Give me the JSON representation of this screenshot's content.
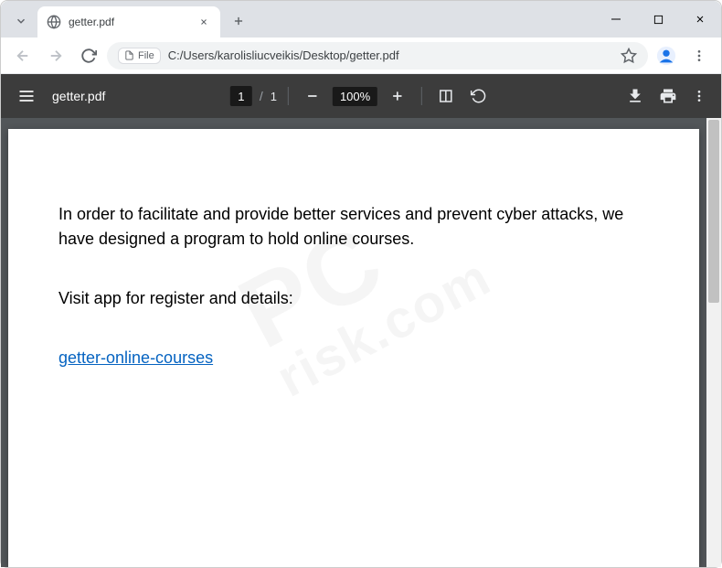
{
  "browser": {
    "tab_title": "getter.pdf",
    "file_chip": "File",
    "url": "C:/Users/karolisliucveikis/Desktop/getter.pdf"
  },
  "pdf_toolbar": {
    "filename": "getter.pdf",
    "page_current": "1",
    "page_separator": "/",
    "page_total": "1",
    "zoom_level": "100%"
  },
  "document": {
    "paragraph1": "In order to facilitate and provide better services and prevent cyber attacks, we have designed a program to hold online courses.",
    "paragraph2": "Visit app for register and details:",
    "link_text": "getter-online-courses"
  },
  "watermark": {
    "main": "PC",
    "sub": "risk.com"
  }
}
